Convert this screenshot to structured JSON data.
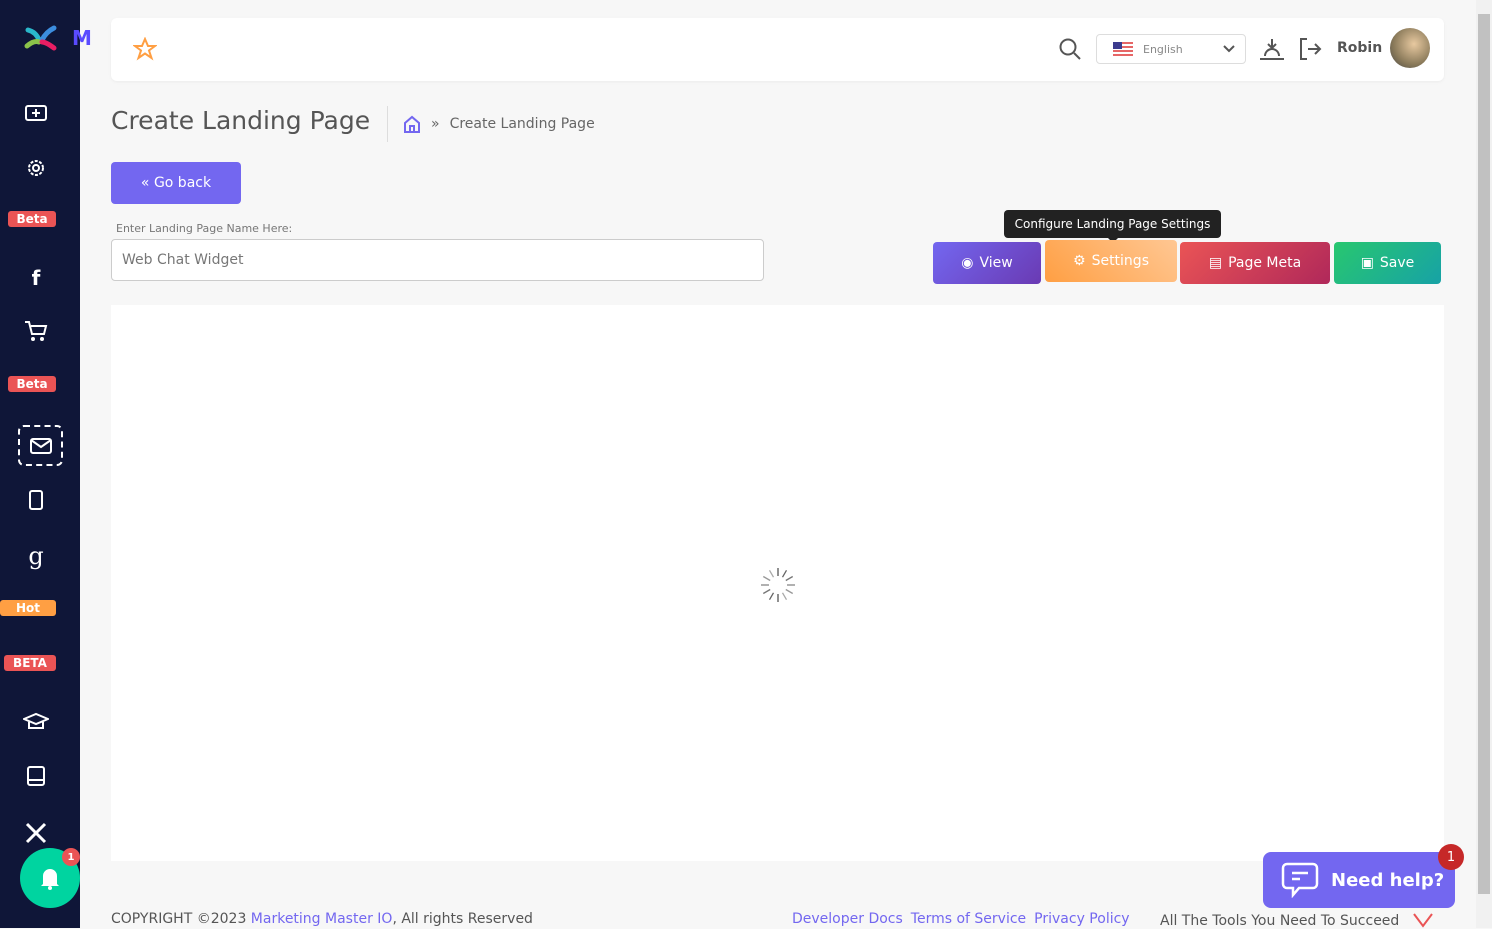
{
  "sidebar": {
    "logo_letter": "M",
    "badges": [
      "Beta",
      "Beta",
      "Hot",
      "BETA"
    ],
    "notification_count": "1",
    "icons": [
      "medical-kit-icon",
      "gear-icon",
      "facebook-icon",
      "cart-icon",
      "mail-icon",
      "mobile-icon",
      "google-icon",
      "graduation-cap-icon",
      "book-icon",
      "tools-icon"
    ]
  },
  "header": {
    "language": "English",
    "user_name": "Robin"
  },
  "page": {
    "title": "Create Landing Page",
    "breadcrumb": "Create Landing Page",
    "go_back": "Go back",
    "name_label": "Enter Landing Page Name Here:",
    "name_value": "Web Chat Widget"
  },
  "actions": {
    "view": "View",
    "settings": "Settings",
    "page_meta": "Page Meta",
    "save": "Save",
    "tooltip": "Configure Landing Page Settings"
  },
  "footer": {
    "copyright": "COPYRIGHT ©2023 ",
    "brand": "Marketing Master IO",
    "rights": ", All rights Reserved",
    "links": [
      "Developer Docs",
      "Terms of Service",
      "Privacy Policy"
    ],
    "tagline": "All The Tools You Need To Succeed"
  },
  "help": {
    "label": "Need help?",
    "count": "1"
  },
  "colors": {
    "primary": "#7367f0",
    "sidebar": "#0f1638",
    "danger": "#ea5455",
    "success": "#28c76f",
    "warning": "#ff9f43"
  }
}
